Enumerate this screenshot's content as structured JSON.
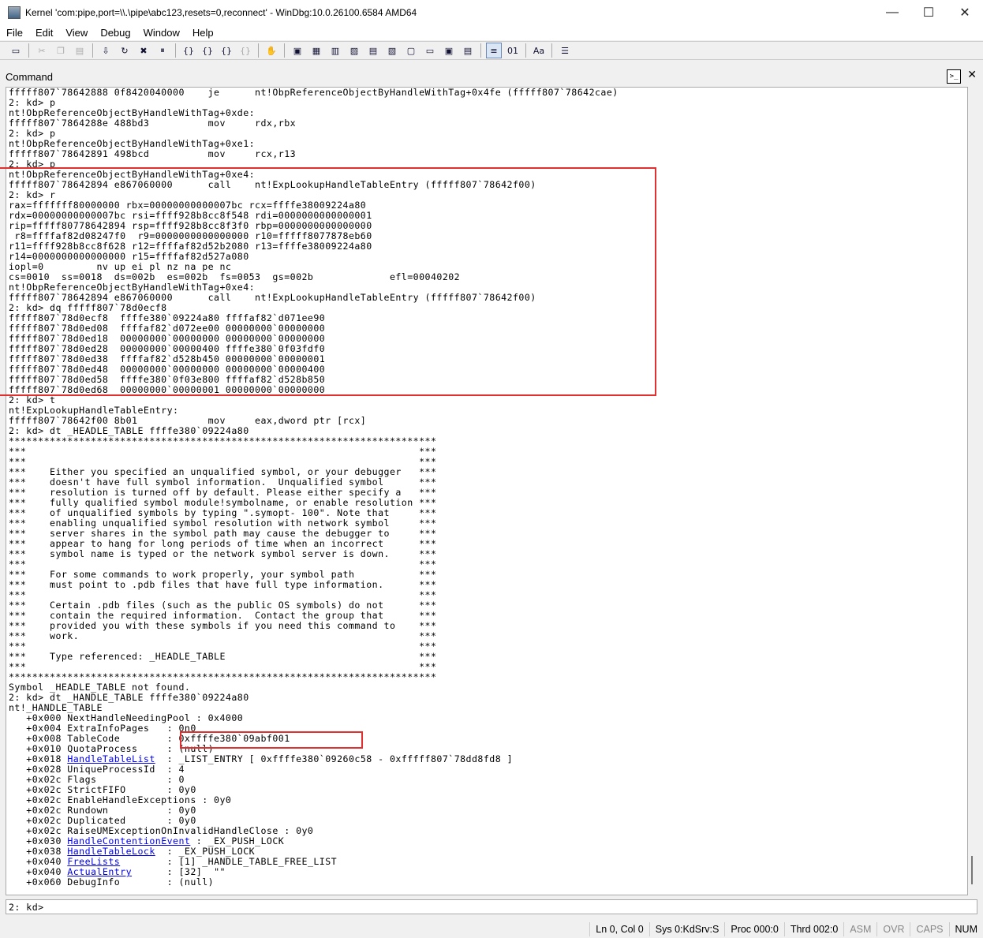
{
  "window": {
    "title": "Kernel 'com:pipe,port=\\\\.\\pipe\\abc123,resets=0,reconnect' - WinDbg:10.0.26100.6584 AMD64",
    "minimize": "—",
    "maximize": "☐",
    "close": "✕"
  },
  "menu": [
    "File",
    "Edit",
    "View",
    "Debug",
    "Window",
    "Help"
  ],
  "toolbar_icons": [
    "open-icon",
    "cut-icon",
    "copy-icon",
    "paste-icon",
    "go-icon",
    "restart-icon",
    "stop-icon",
    "break-icon",
    "step-into-icon",
    "step-over-icon",
    "step-out-icon",
    "run-to-cursor-icon",
    "hand-icon",
    "command-window-icon",
    "watch-icon",
    "locals-icon",
    "registers-icon",
    "memory-icon",
    "call-stack-icon",
    "disassembly-icon",
    "scratch-pad-icon",
    "source-mode-icon",
    "hex-mode-icon",
    "font-icon",
    "options-icon"
  ],
  "command_window": {
    "label": "Command",
    "output_before_links": "fffff807`78642888 0f8420040000    je      nt!ObpReferenceObjectByHandleWithTag+0x4fe (fffff807`78642cae)\n2: kd> p\nnt!ObpReferenceObjectByHandleWithTag+0xde:\nfffff807`7864288e 488bd3          mov     rdx,rbx\n2: kd> p\nnt!ObpReferenceObjectByHandleWithTag+0xe1:\nfffff807`78642891 498bcd          mov     rcx,r13\n2: kd> p\nnt!ObpReferenceObjectByHandleWithTag+0xe4:\nfffff807`78642894 e867060000      call    nt!ExpLookupHandleTableEntry (fffff807`78642f00)\n2: kd> r\nrax=fffffff80000000 rbx=00000000000007bc rcx=ffffe38009224a80\nrdx=00000000000007bc rsi=ffff928b8cc8f548 rdi=0000000000000001\nrip=fffff80778642894 rsp=ffff928b8cc8f3f0 rbp=0000000000000000\n r8=ffffaf82d08247f0  r9=0000000000000000 r10=fffff8077878eb60\nr11=ffff928b8cc8f628 r12=ffffaf82d52b2080 r13=ffffe38009224a80\nr14=0000000000000000 r15=ffffaf82d527a080\niopl=0         nv up ei pl nz na pe nc\ncs=0010  ss=0018  ds=002b  es=002b  fs=0053  gs=002b             efl=00040202\nnt!ObpReferenceObjectByHandleWithTag+0xe4:\nfffff807`78642894 e867060000      call    nt!ExpLookupHandleTableEntry (fffff807`78642f00)\n2: kd> dq fffff807`78d0ecf8\nfffff807`78d0ecf8  ffffe380`09224a80 ffffaf82`d071ee90\nfffff807`78d0ed08  ffffaf82`d072ee00 00000000`00000000\nfffff807`78d0ed18  00000000`00000000 00000000`00000000\nfffff807`78d0ed28  00000000`00000400 ffffe380`0f03fdf0\nfffff807`78d0ed38  ffffaf82`d528b450 00000000`00000001\nfffff807`78d0ed48  00000000`00000000 00000000`00000400\nfffff807`78d0ed58  ffffe380`0f03e800 ffffaf82`d528b850\nfffff807`78d0ed68  00000000`00000001 00000000`00000000\n2: kd> t\nnt!ExpLookupHandleTableEntry:\nfffff807`78642f00 8b01            mov     eax,dword ptr [rcx]\n2: kd> dt _HEADLE_TABLE ffffe380`09224a80\n*************************************************************************\n***                                                                   ***\n***                                                                   ***\n***    Either you specified an unqualified symbol, or your debugger   ***\n***    doesn't have full symbol information.  Unqualified symbol      ***\n***    resolution is turned off by default. Please either specify a   ***\n***    fully qualified symbol module!symbolname, or enable resolution ***\n***    of unqualified symbols by typing \".symopt- 100\". Note that     ***\n***    enabling unqualified symbol resolution with network symbol     ***\n***    server shares in the symbol path may cause the debugger to     ***\n***    appear to hang for long periods of time when an incorrect      ***\n***    symbol name is typed or the network symbol server is down.     ***\n***                                                                   ***\n***    For some commands to work properly, your symbol path           ***\n***    must point to .pdb files that have full type information.      ***\n***                                                                   ***\n***    Certain .pdb files (such as the public OS symbols) do not      ***\n***    contain the required information.  Contact the group that      ***\n***    provided you with these symbols if you need this command to    ***\n***    work.                                                          ***\n***                                                                   ***\n***    Type referenced: _HEADLE_TABLE                                 ***\n***                                                                   ***\n*************************************************************************\nSymbol _HEADLE_TABLE not found.\n2: kd> dt _HANDLE_TABLE ffffe380`09224a80\nnt!_HANDLE_TABLE\n   +0x000 NextHandleNeedingPool : 0x4000\n   +0x004 ExtraInfoPages   : 0n0\n   +0x008 TableCode        : 0xffffe380`09abf001\n   +0x010 QuotaProcess     : (null)",
    "field_rows": [
      {
        "offset": "   +0x018 ",
        "link": "HandleTableList",
        "rest": "  : _LIST_ENTRY [ 0xffffe380`09260c58 - 0xfffff807`78dd8fd8 ]"
      },
      {
        "offset": "   +0x028 UniqueProcessId  : 4",
        "link": "",
        "rest": ""
      },
      {
        "offset": "   +0x02c Flags            : 0",
        "link": "",
        "rest": ""
      },
      {
        "offset": "   +0x02c StrictFIFO       : 0y0",
        "link": "",
        "rest": ""
      },
      {
        "offset": "   +0x02c EnableHandleExceptions : 0y0",
        "link": "",
        "rest": ""
      },
      {
        "offset": "   +0x02c Rundown          : 0y0",
        "link": "",
        "rest": ""
      },
      {
        "offset": "   +0x02c Duplicated       : 0y0",
        "link": "",
        "rest": ""
      },
      {
        "offset": "   +0x02c RaiseUMExceptionOnInvalidHandleClose : 0y0",
        "link": "",
        "rest": ""
      },
      {
        "offset": "   +0x030 ",
        "link": "HandleContentionEvent",
        "rest": " : _EX_PUSH_LOCK"
      },
      {
        "offset": "   +0x038 ",
        "link": "HandleTableLock",
        "rest": "  : _EX_PUSH_LOCK"
      },
      {
        "offset": "   +0x040 ",
        "link": "FreeLists",
        "rest": "        : [1] _HANDLE_TABLE_FREE_LIST"
      },
      {
        "offset": "   +0x040 ",
        "link": "ActualEntry",
        "rest": "      : [32]  \"\""
      },
      {
        "offset": "   +0x060 DebugInfo        : (null)",
        "link": "",
        "rest": ""
      }
    ],
    "prompt": "2: kd>",
    "input_value": ""
  },
  "status_bar": {
    "position": "Ln 0, Col 0",
    "sys": "Sys 0:KdSrv:S",
    "proc": "Proc 000:0",
    "thrd": "Thrd 002:0",
    "asm": "ASM",
    "ovr": "OVR",
    "caps": "CAPS",
    "num": "NUM"
  },
  "highlight_color": "#e03030",
  "link_color": "#0000ee"
}
